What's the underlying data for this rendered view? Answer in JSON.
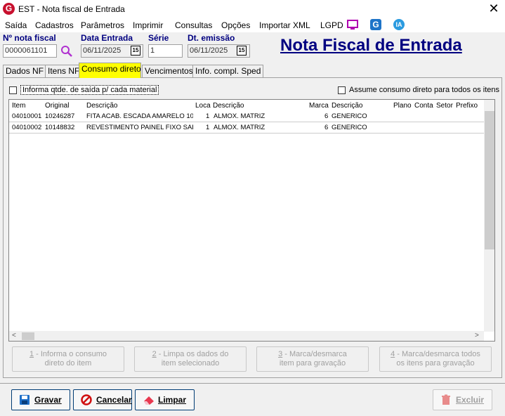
{
  "window": {
    "title": "EST - Nota fiscal de Entrada",
    "logo_letter": "G",
    "close_glyph": "✕"
  },
  "menu": {
    "items": [
      "Saída",
      "Cadastros",
      "Parâmetros",
      "Imprimir",
      "Consultas",
      "Opções",
      "Importar XML",
      "LGPD"
    ],
    "icons": [
      "monitor-icon",
      "g-app-icon",
      "ia-icon"
    ],
    "g_label": "G",
    "ia_label": "IA"
  },
  "header": {
    "nota_label": "Nº nota fiscal",
    "nota_value": "0000061101",
    "data_entrada_label": "Data Entrada",
    "data_entrada_value": "06/11/2025",
    "serie_label": "Série",
    "serie_value": "1",
    "dt_emissao_label": "Dt. emissão",
    "dt_emissao_value": "06/11/2025",
    "calendar_glyph": "15",
    "big_title": "Nota Fiscal de Entrada"
  },
  "tabs": [
    {
      "label": "Dados NF",
      "active": false
    },
    {
      "label": "Itens NF",
      "active": false
    },
    {
      "label": "Consumo direto",
      "active": true
    },
    {
      "label": "Vencimentos",
      "active": false
    },
    {
      "label": "Info. compl. Sped",
      "active": false
    }
  ],
  "options": {
    "informa_label": "Informa qtde. de saída p/ cada material",
    "informa_checked": false,
    "assume_label": "Assume consumo direto para todos os itens",
    "assume_checked": false
  },
  "grid": {
    "columns": [
      "Item",
      "Original",
      "Descrição",
      "Loca",
      "Descrição",
      "Marca",
      "Descrição",
      "Plano",
      "Conta",
      "Setor",
      "Prefixo"
    ],
    "rows": [
      [
        "04010001",
        "10246287",
        "FITA ACAB. ESCADA AMARELO 10",
        "1",
        "ALMOX. MATRIZ",
        "6",
        "GENERICO",
        "",
        "",
        "",
        ""
      ],
      [
        "04010002",
        "10148832",
        "REVESTIMENTO PAINEL FIXO SAL",
        "1",
        "ALMOX. MATRIZ",
        "6",
        "GENERICO",
        "",
        "",
        "",
        ""
      ]
    ]
  },
  "actions": [
    {
      "num": "1",
      "label_rest": " - Informa o consumo",
      "line2": "direto do item"
    },
    {
      "num": "2",
      "label_rest": " - Limpa os dados do",
      "line2": "item selecionado"
    },
    {
      "num": "3",
      "label_rest": " - Marca/desmarca",
      "line2": "item para gravação"
    },
    {
      "num": "4",
      "label_rest": " - Marca/desmarca todos",
      "line2": "os itens para gravação"
    }
  ],
  "footer": {
    "gravar": "Gravar",
    "cancelar": "Cancelar",
    "limpar": "Limpar",
    "excluir": "Excluir"
  },
  "colors": {
    "accent_navy": "#000080",
    "active_tab": "#ffff00",
    "logo_red": "#c8102e"
  }
}
